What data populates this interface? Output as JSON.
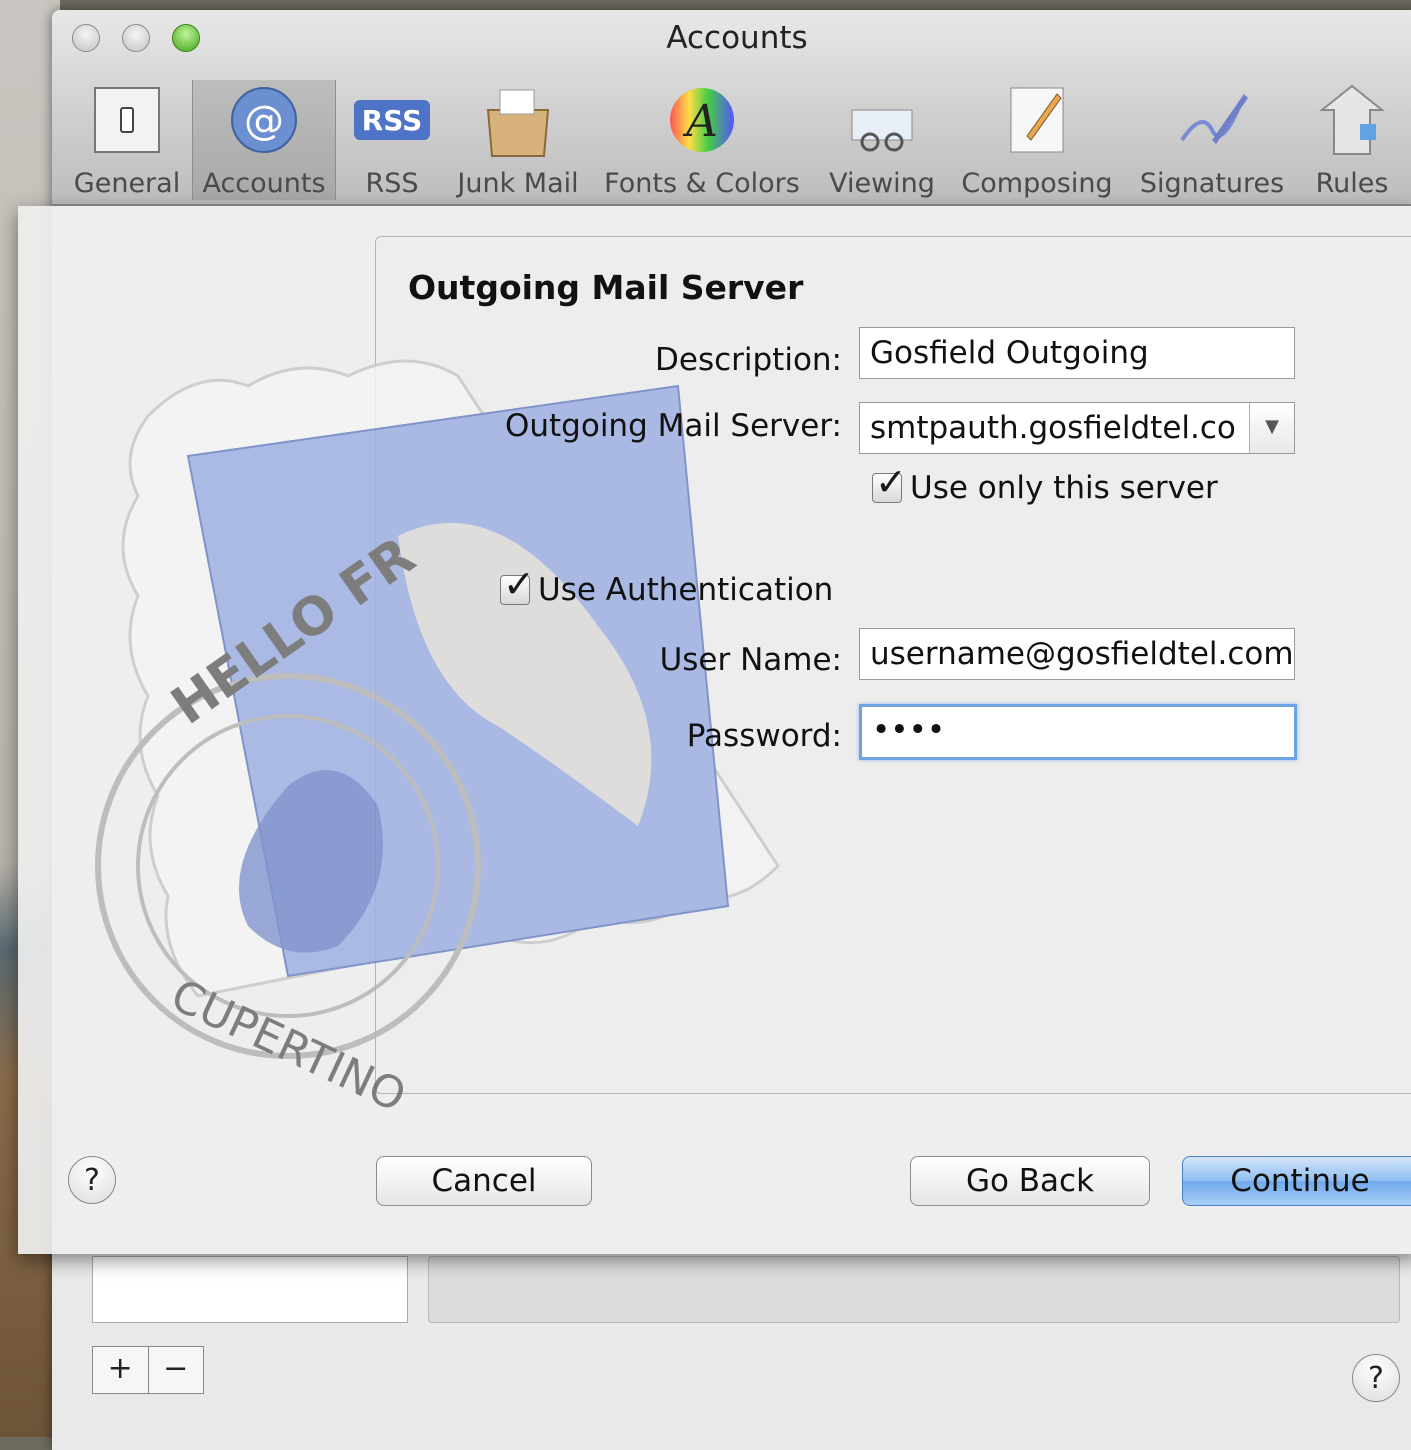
{
  "window": {
    "title": "Accounts"
  },
  "toolbar": {
    "items": [
      {
        "label": "General",
        "icon": "general-switch-icon"
      },
      {
        "label": "Accounts",
        "icon": "at-sign-icon",
        "selected": true
      },
      {
        "label": "RSS",
        "icon": "rss-icon"
      },
      {
        "label": "Junk Mail",
        "icon": "junk-mail-icon"
      },
      {
        "label": "Fonts & Colors",
        "icon": "fonts-colors-icon"
      },
      {
        "label": "Viewing",
        "icon": "viewing-icon"
      },
      {
        "label": "Composing",
        "icon": "composing-icon"
      },
      {
        "label": "Signatures",
        "icon": "signatures-icon"
      },
      {
        "label": "Rules",
        "icon": "rules-icon"
      }
    ]
  },
  "sheet": {
    "title": "Outgoing Mail Server",
    "description_label": "Description:",
    "description_value": "Gosfield Outgoing",
    "server_label": "Outgoing Mail Server:",
    "server_value": "smtpauth.gosfieldtel.co",
    "use_only_server_label": "Use only this server",
    "use_only_server_checked": true,
    "use_auth_label": "Use Authentication",
    "use_auth_checked": true,
    "username_label": "User Name:",
    "username_value": "username@gosfieldtel.com",
    "password_label": "Password:",
    "password_value": "••••",
    "cancel_label": "Cancel",
    "go_back_label": "Go Back",
    "continue_label": "Continue",
    "help_label": "?"
  },
  "background": {
    "add_label": "+",
    "remove_label": "−",
    "help_label": "?"
  },
  "colors": {
    "accent_blue": "#6fa9ec",
    "focus_ring": "#6ea3e2",
    "traffic_green": "#3fa31a"
  }
}
